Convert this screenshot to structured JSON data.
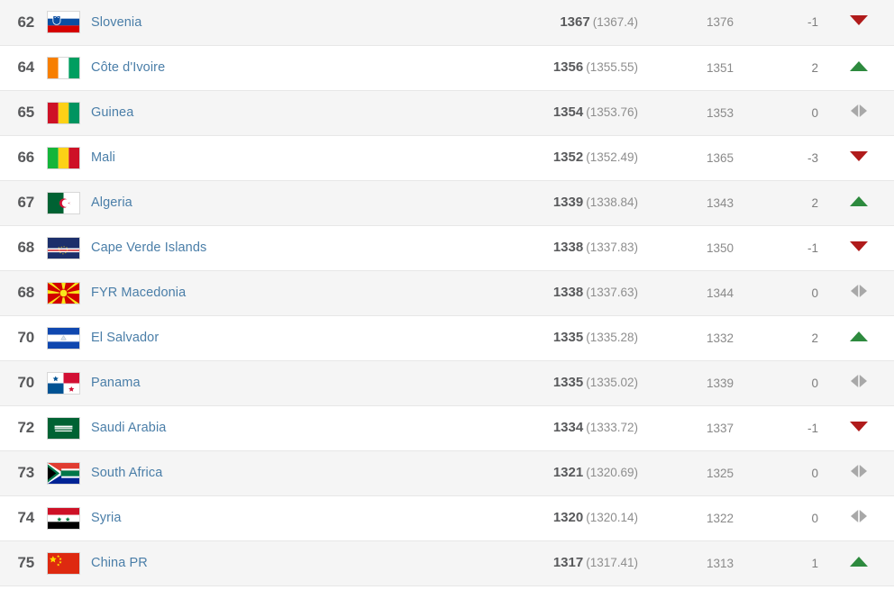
{
  "table": {
    "columns": [
      "rank",
      "flag",
      "team",
      "points",
      "previous_points",
      "change",
      "movement"
    ],
    "colors": {
      "link": "#4a7ea8",
      "rank_text": "#58595b",
      "points_text": "#58595b",
      "muted_text": "#8e8e8e",
      "row_alt_background": "#f5f5f5",
      "row_background": "#ffffff",
      "row_border": "#e7e7e7",
      "arrow_up": "#2d8a3e",
      "arrow_down": "#b01b1b",
      "arrow_same": "#a8a8a8"
    },
    "rows": [
      {
        "rank": "62",
        "team": "Slovenia",
        "flag": "flag-slovenia",
        "points": "1367",
        "points_exact": "(1367.4)",
        "previous_points": "1376",
        "change": "-1",
        "movement": "down"
      },
      {
        "rank": "64",
        "team": "Côte d'Ivoire",
        "flag": "flag-cote-divoire",
        "points": "1356",
        "points_exact": "(1355.55)",
        "previous_points": "1351",
        "change": "2",
        "movement": "up"
      },
      {
        "rank": "65",
        "team": "Guinea",
        "flag": "flag-guinea",
        "points": "1354",
        "points_exact": "(1353.76)",
        "previous_points": "1353",
        "change": "0",
        "movement": "same"
      },
      {
        "rank": "66",
        "team": "Mali",
        "flag": "flag-mali",
        "points": "1352",
        "points_exact": "(1352.49)",
        "previous_points": "1365",
        "change": "-3",
        "movement": "down"
      },
      {
        "rank": "67",
        "team": "Algeria",
        "flag": "flag-algeria",
        "points": "1339",
        "points_exact": "(1338.84)",
        "previous_points": "1343",
        "change": "2",
        "movement": "up"
      },
      {
        "rank": "68",
        "team": "Cape Verde Islands",
        "flag": "flag-cape-verde",
        "points": "1338",
        "points_exact": "(1337.83)",
        "previous_points": "1350",
        "change": "-1",
        "movement": "down"
      },
      {
        "rank": "68",
        "team": "FYR Macedonia",
        "flag": "flag-macedonia",
        "points": "1338",
        "points_exact": "(1337.63)",
        "previous_points": "1344",
        "change": "0",
        "movement": "same"
      },
      {
        "rank": "70",
        "team": "El Salvador",
        "flag": "flag-el-salvador",
        "points": "1335",
        "points_exact": "(1335.28)",
        "previous_points": "1332",
        "change": "2",
        "movement": "up"
      },
      {
        "rank": "70",
        "team": "Panama",
        "flag": "flag-panama",
        "points": "1335",
        "points_exact": "(1335.02)",
        "previous_points": "1339",
        "change": "0",
        "movement": "same"
      },
      {
        "rank": "72",
        "team": "Saudi Arabia",
        "flag": "flag-saudi-arabia",
        "points": "1334",
        "points_exact": "(1333.72)",
        "previous_points": "1337",
        "change": "-1",
        "movement": "down"
      },
      {
        "rank": "73",
        "team": "South Africa",
        "flag": "flag-south-africa",
        "points": "1321",
        "points_exact": "(1320.69)",
        "previous_points": "1325",
        "change": "0",
        "movement": "same"
      },
      {
        "rank": "74",
        "team": "Syria",
        "flag": "flag-syria",
        "points": "1320",
        "points_exact": "(1320.14)",
        "previous_points": "1322",
        "change": "0",
        "movement": "same"
      },
      {
        "rank": "75",
        "team": "China PR",
        "flag": "flag-china",
        "points": "1317",
        "points_exact": "(1317.41)",
        "previous_points": "1313",
        "change": "1",
        "movement": "up"
      }
    ]
  }
}
